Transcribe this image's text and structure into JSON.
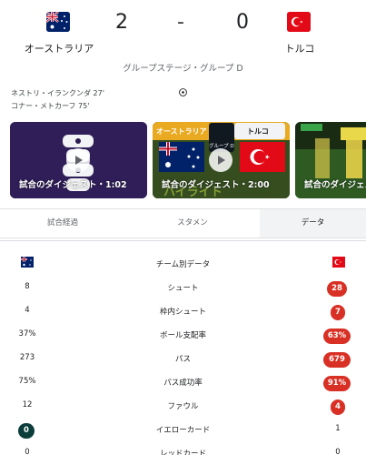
{
  "match": {
    "home": {
      "name": "オーストラリア",
      "score": "2",
      "flag": "australia-flag"
    },
    "away": {
      "name": "トルコ",
      "score": "0",
      "flag": "turkey-flag"
    },
    "separator": "-",
    "stage": "グループステージ・グループ D"
  },
  "scorers": [
    "ネストリ・イランクンダ 27'",
    "コナー・メトカーフ 75'"
  ],
  "videos": [
    {
      "caption": "試合のダイジェスト・1:02"
    },
    {
      "caption": "試合のダイジェスト・2:00",
      "home_label": "オーストラリア",
      "away_label": "トルコ",
      "group_label": "グループ D",
      "big_text": "ハイライト"
    },
    {
      "caption": "試合のダイジェスト"
    }
  ],
  "tabs": [
    {
      "label": "試合経過"
    },
    {
      "label": "スタメン"
    },
    {
      "label": "データ",
      "active": true
    }
  ],
  "stats": {
    "header": "チーム別データ",
    "rows": [
      {
        "label": "シュート",
        "home": "8",
        "away": "28",
        "highlight": "away"
      },
      {
        "label": "枠内シュート",
        "home": "4",
        "away": "7",
        "highlight": "away"
      },
      {
        "label": "ボール支配率",
        "home": "37%",
        "away": "63%",
        "highlight": "away"
      },
      {
        "label": "パス",
        "home": "273",
        "away": "679",
        "highlight": "away"
      },
      {
        "label": "パス成功率",
        "home": "75%",
        "away": "91%",
        "highlight": "away"
      },
      {
        "label": "ファウル",
        "home": "12",
        "away": "4",
        "highlight": "home-none-away"
      },
      {
        "label": "イエローカード",
        "home": "0",
        "away": "1",
        "highlight": "home"
      },
      {
        "label": "レッドカード",
        "home": "0",
        "away": "0",
        "highlight": "none"
      }
    ]
  },
  "colors": {
    "highlight_red": "#d93025",
    "highlight_dark": "#0b3d3a",
    "turkey_red": "#e30a17",
    "australia_blue": "#012169",
    "video1_bg": "#2b1b4f",
    "video2_bg": "#1d2a1c"
  }
}
